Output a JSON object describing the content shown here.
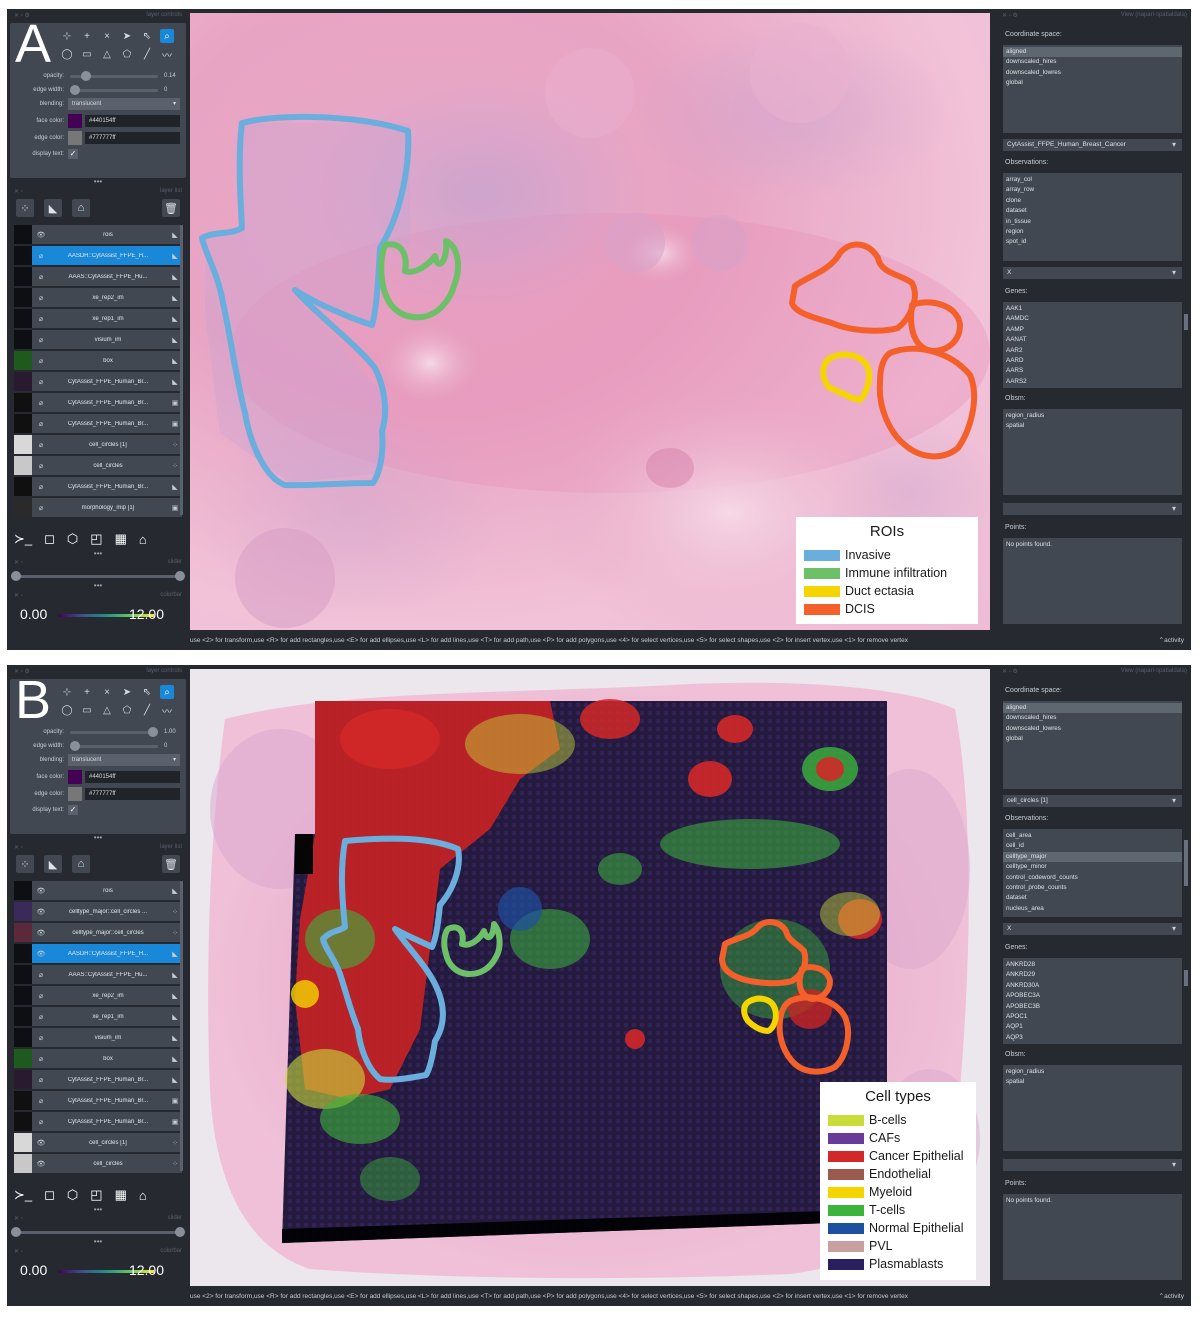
{
  "panels": [
    {
      "letter": "A",
      "headers": {
        "layer_controls": "layer controls",
        "layer_list": "layer list",
        "slider": "slider",
        "colorbar": "colorbar",
        "viewer": "View (napari-spatialdata)"
      },
      "controls": {
        "opacity_label": "opacity:",
        "opacity_value": "0.14",
        "opacity_fraction": 0.14,
        "edge_width_label": "edge width:",
        "edge_width_value": "0",
        "blending_label": "blending:",
        "blending_value": "translucent",
        "face_color_label": "face color:",
        "face_color_value": "#440154ff",
        "face_color": "#440154",
        "edge_color_label": "edge color:",
        "edge_color_value": "#777777ff",
        "edge_color": "#777777",
        "display_text_label": "display text:"
      },
      "layers": [
        {
          "name": "rois",
          "type": "shapes",
          "selected": false,
          "visible": true,
          "thumb": "#0e0f12"
        },
        {
          "name": "AASDH::CytAssist_FFPE_H...",
          "type": "shapes",
          "selected": true,
          "visible": false,
          "thumb": "#0e0f12"
        },
        {
          "name": "AAAS::CytAssist_FFPE_Hu...",
          "type": "shapes",
          "selected": false,
          "visible": false,
          "thumb": "#0e0f12"
        },
        {
          "name": "xe_rep2_im",
          "type": "shapes",
          "selected": false,
          "visible": false,
          "thumb": "#0e0f12"
        },
        {
          "name": "xe_rep1_im",
          "type": "shapes",
          "selected": false,
          "visible": false,
          "thumb": "#0e0f12"
        },
        {
          "name": "visium_im",
          "type": "shapes",
          "selected": false,
          "visible": false,
          "thumb": "#0e0f12"
        },
        {
          "name": "box",
          "type": "shapes",
          "selected": false,
          "visible": false,
          "thumb": "#1e5a1e"
        },
        {
          "name": "CytAssist_FFPE_Human_Br...",
          "type": "shapes",
          "selected": false,
          "visible": false,
          "thumb": "#2a1a30"
        },
        {
          "name": "CytAssist_FFPE_Human_Br...",
          "type": "image",
          "selected": false,
          "visible": false,
          "thumb": "#101010"
        },
        {
          "name": "CytAssist_FFPE_Human_Br...",
          "type": "image",
          "selected": false,
          "visible": false,
          "thumb": "#101010"
        },
        {
          "name": "cell_circles [1]",
          "type": "points",
          "selected": false,
          "visible": false,
          "thumb": "#d8d8d8"
        },
        {
          "name": "cell_circles",
          "type": "points",
          "selected": false,
          "visible": false,
          "thumb": "#c8c8c8"
        },
        {
          "name": "CytAssist_FFPE_Human_Br...",
          "type": "shapes",
          "selected": false,
          "visible": false,
          "thumb": "#101010"
        },
        {
          "name": "morphology_mip [1]",
          "type": "image",
          "selected": false,
          "visible": false,
          "thumb": "#2a2a2a"
        }
      ],
      "colorbar": {
        "min": "0.00",
        "max": "12.00"
      },
      "status": "use <2> for transform,use <R> for add rectangles,use <E> for add ellipses,use <L> for add lines,use <T> for add path,use <P> for add polygons,use <4> for select vertices,use <5> for select shapes,use <2> for insert vertex,use <1> for remove vertex",
      "activity": "activity",
      "legend": {
        "title": "ROIs",
        "items": [
          {
            "label": "Invasive",
            "color": "#6aaede"
          },
          {
            "label": "Immune infiltration",
            "color": "#6cc068"
          },
          {
            "label": "Duct ectasia",
            "color": "#f5d500"
          },
          {
            "label": "DCIS",
            "color": "#f4602a"
          }
        ]
      },
      "right": {
        "coord_label": "Coordinate space:",
        "coord_items": [
          "aligned",
          "downscaled_hires",
          "downscaled_lowres",
          "global"
        ],
        "coord_selected": 0,
        "dataset_select": "CytAssist_FFPE_Human_Breast_Cancer",
        "obs_label": "Observations:",
        "obs_items": [
          "array_col",
          "array_row",
          "clone",
          "dataset",
          "in_tissue",
          "region",
          "spot_id"
        ],
        "obs_selected": -1,
        "x_select": "X",
        "genes_label": "Genes:",
        "genes_items": [
          "AAK1",
          "AAMDC",
          "AAMP",
          "AANAT",
          "AAR2",
          "AARD",
          "AARS",
          "AARS2"
        ],
        "obsm_label": "Obsm:",
        "obsm_items": [
          "region_radius",
          "spatial"
        ],
        "points_label": "Points:",
        "points_items": [
          "No points found."
        ]
      }
    },
    {
      "letter": "B",
      "headers": {
        "layer_controls": "layer controls",
        "layer_list": "layer list",
        "slider": "slider",
        "colorbar": "colorbar",
        "viewer": "View (napari-spatialdata)"
      },
      "controls": {
        "opacity_label": "opacity:",
        "opacity_value": "1.00",
        "opacity_fraction": 1.0,
        "edge_width_label": "edge width:",
        "edge_width_value": "0",
        "blending_label": "blending:",
        "blending_value": "translucent",
        "face_color_label": "face color:",
        "face_color_value": "#440154ff",
        "face_color": "#440154",
        "edge_color_label": "edge color:",
        "edge_color_value": "#777777ff",
        "edge_color": "#777777",
        "display_text_label": "display text:"
      },
      "layers": [
        {
          "name": "rois",
          "type": "shapes",
          "selected": false,
          "visible": true,
          "thumb": "#0e0f12"
        },
        {
          "name": "celltype_major::cell_circles ...",
          "type": "points",
          "selected": false,
          "visible": true,
          "thumb": "#3a2a5a"
        },
        {
          "name": "celltype_major::cell_circles",
          "type": "points",
          "selected": false,
          "visible": true,
          "thumb": "#5a2a3a"
        },
        {
          "name": "AASDH::CytAssist_FFPE_H...",
          "type": "shapes",
          "selected": true,
          "visible": true,
          "thumb": "#0e0f12"
        },
        {
          "name": "AAAS::CytAssist_FFPE_Hu...",
          "type": "shapes",
          "selected": false,
          "visible": false,
          "thumb": "#0e0f12"
        },
        {
          "name": "xe_rep2_im",
          "type": "shapes",
          "selected": false,
          "visible": false,
          "thumb": "#0e0f12"
        },
        {
          "name": "xe_rep1_im",
          "type": "shapes",
          "selected": false,
          "visible": false,
          "thumb": "#0e0f12"
        },
        {
          "name": "visium_im",
          "type": "shapes",
          "selected": false,
          "visible": false,
          "thumb": "#0e0f12"
        },
        {
          "name": "box",
          "type": "shapes",
          "selected": false,
          "visible": false,
          "thumb": "#1e5a1e"
        },
        {
          "name": "CytAssist_FFPE_Human_Br...",
          "type": "shapes",
          "selected": false,
          "visible": false,
          "thumb": "#2a1a30"
        },
        {
          "name": "CytAssist_FFPE_Human_Br...",
          "type": "image",
          "selected": false,
          "visible": false,
          "thumb": "#101010"
        },
        {
          "name": "CytAssist_FFPE_Human_Br...",
          "type": "image",
          "selected": false,
          "visible": false,
          "thumb": "#101010"
        },
        {
          "name": "cell_circles [1]",
          "type": "points",
          "selected": false,
          "visible": true,
          "thumb": "#d8d8d8"
        },
        {
          "name": "cell_circles",
          "type": "points",
          "selected": false,
          "visible": true,
          "thumb": "#c8c8c8"
        }
      ],
      "colorbar": {
        "min": "0.00",
        "max": "12.00"
      },
      "status": "use <2> for transform,use <R> for add rectangles,use <E> for add ellipses,use <L> for add lines,use <T> for add path,use <P> for add polygons,use <4> for select vertices,use <5> for select shapes,use <2> for insert vertex,use <1> for remove vertex",
      "activity": "activity",
      "legend": {
        "title": "Cell types",
        "items": [
          {
            "label": "B-cells",
            "color": "#c8dc3a"
          },
          {
            "label": "CAFs",
            "color": "#6a3a9a"
          },
          {
            "label": "Cancer Epithelial",
            "color": "#d22828"
          },
          {
            "label": "Endothelial",
            "color": "#9a5a50"
          },
          {
            "label": "Myeloid",
            "color": "#f5d500"
          },
          {
            "label": "T-cells",
            "color": "#3cb43c"
          },
          {
            "label": "Normal Epithelial",
            "color": "#1e50a0"
          },
          {
            "label": "PVL",
            "color": "#c8a0a0"
          },
          {
            "label": "Plasmablasts",
            "color": "#2a2060"
          }
        ]
      },
      "right": {
        "coord_label": "Coordinate space:",
        "coord_items": [
          "aligned",
          "downscaled_hires",
          "downscaled_lowres",
          "global"
        ],
        "coord_selected": 0,
        "dataset_select": "cell_circles [1]",
        "obs_label": "Observations:",
        "obs_items": [
          "cell_area",
          "cell_id",
          "celltype_major",
          "celltype_minor",
          "control_codeword_counts",
          "control_probe_counts",
          "dataset",
          "nucleus_area"
        ],
        "obs_selected": 2,
        "x_select": "X",
        "genes_label": "Genes:",
        "genes_items": [
          "ANKRD28",
          "ANKRD29",
          "ANKRD30A",
          "APOBEC3A",
          "APOBEC3B",
          "APOC1",
          "AQP1",
          "AQP3"
        ],
        "obsm_label": "Obsm:",
        "obsm_items": [
          "region_radius",
          "spatial"
        ],
        "points_label": "Points:",
        "points_items": [
          "No points found."
        ]
      }
    }
  ]
}
